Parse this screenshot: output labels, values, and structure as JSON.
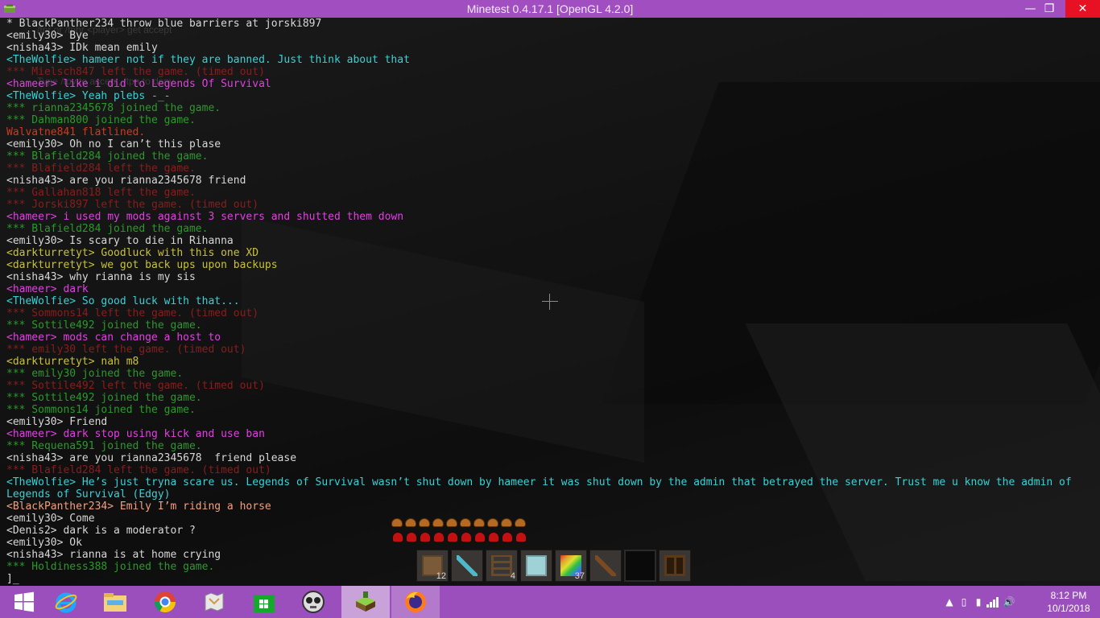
{
  "window": {
    "title": "Minetest 0.4.17.1 [OpenGL 4.2.0]"
  },
  "ghost_text": [
    "/tpr or /tphr <player> get accept",
    "Type /tpy to accept, /tpn to deny"
  ],
  "colors": {
    "normal": "#d8d8d8",
    "join": "#2a9a2a",
    "leave": "#8a1d1d",
    "death": "#d03a1e",
    "emote": "#d8d8d8",
    "wolfie": "#38d2d6",
    "hameer": "#e040e0",
    "darkturret": "#c8c238",
    "blackpanther": "#f0a080"
  },
  "chat": [
    {
      "text": "* BlackPanther234 throw blue barriers at jorski897",
      "kind": "emote"
    },
    {
      "text": "<emily30> Bye",
      "kind": "normal"
    },
    {
      "text": "<nisha43> IDk mean emily",
      "kind": "normal"
    },
    {
      "text": "<TheWolfie> hameer not if they are banned. Just think about that",
      "kind": "wolfie"
    },
    {
      "text": "*** Mielsch847 left the game. (timed out)",
      "kind": "leave"
    },
    {
      "text": "<hameer> like i did to Legends Of Survival",
      "kind": "hameer"
    },
    {
      "text": "<TheWolfie> Yeah plebs -_-",
      "kind": "wolfie"
    },
    {
      "text": "*** rianna2345678 joined the game.",
      "kind": "join"
    },
    {
      "text": "*** Dahman800 joined the game.",
      "kind": "join"
    },
    {
      "text": "Walvatne841 flatlined.",
      "kind": "death"
    },
    {
      "text": "<emily30> Oh no I can’t this plase",
      "kind": "normal"
    },
    {
      "text": "*** Blafield284 joined the game.",
      "kind": "join"
    },
    {
      "text": "*** Blafield284 left the game.",
      "kind": "leave"
    },
    {
      "text": "<nisha43> are you rianna2345678 friend",
      "kind": "normal"
    },
    {
      "text": "*** Gallahan818 left the game.",
      "kind": "leave"
    },
    {
      "text": "*** Jorski897 left the game. (timed out)",
      "kind": "leave"
    },
    {
      "text": "<hameer> i used my mods against 3 servers and shutted them down",
      "kind": "hameer"
    },
    {
      "text": "*** Blafield284 joined the game.",
      "kind": "join"
    },
    {
      "text": "<emily30> Is scary to die in Rihanna",
      "kind": "normal"
    },
    {
      "text": "<darkturretyt> Goodluck with this one XD",
      "kind": "darkturret"
    },
    {
      "text": "<darkturretyt> we got back ups upon backups",
      "kind": "darkturret"
    },
    {
      "text": "<nisha43> why rianna is my sis",
      "kind": "normal"
    },
    {
      "text": "<hameer> dark",
      "kind": "hameer"
    },
    {
      "text": "<TheWolfie> So good luck with that...",
      "kind": "wolfie"
    },
    {
      "text": "*** Sommons14 left the game. (timed out)",
      "kind": "leave"
    },
    {
      "text": "*** Sottile492 joined the game.",
      "kind": "join"
    },
    {
      "text": "<hameer> mods can change a host to",
      "kind": "hameer"
    },
    {
      "text": "*** emily30 left the game. (timed out)",
      "kind": "leave"
    },
    {
      "text": "<darkturretyt> nah m8",
      "kind": "darkturret"
    },
    {
      "text": "*** emily30 joined the game.",
      "kind": "join"
    },
    {
      "text": "*** Sottile492 left the game. (timed out)",
      "kind": "leave"
    },
    {
      "text": "*** Sottile492 joined the game.",
      "kind": "join"
    },
    {
      "text": "*** Sommons14 joined the game.",
      "kind": "join"
    },
    {
      "text": "<emily30> Friend",
      "kind": "normal"
    },
    {
      "text": "<hameer> dark stop using kick and use ban",
      "kind": "hameer"
    },
    {
      "text": "*** Requena591 joined the game.",
      "kind": "join"
    },
    {
      "text": "<nisha43> are you rianna2345678  friend please",
      "kind": "normal"
    },
    {
      "text": "*** Blafield284 left the game. (timed out)",
      "kind": "leave"
    },
    {
      "text": "<TheWolfie> He’s just tryna scare us. Legends of Survival wasn’t shut down by hameer it was shut down by the admin that betrayed the server. Trust me u know the admin of Legends of Survival (Edgy)",
      "kind": "wolfie"
    },
    {
      "text": "<BlackPanther234> Emily I’m riding a horse",
      "kind": "blackpanther"
    },
    {
      "text": "<emily30> Come",
      "kind": "normal"
    },
    {
      "text": "<Denis2> dark is a moderator ?",
      "kind": "normal"
    },
    {
      "text": "<emily30> Ok",
      "kind": "normal"
    },
    {
      "text": "<nisha43> rianna is at home crying",
      "kind": "normal"
    },
    {
      "text": "*** Holdiness388 joined the game.",
      "kind": "join"
    }
  ],
  "input": {
    "text": "]_"
  },
  "hud": {
    "hunger_count": 10,
    "hearts_count": 10,
    "hotbar": [
      {
        "icon": "wood-planks-icon",
        "count": "12",
        "color": "#7a5a38"
      },
      {
        "icon": "diamond-shovel-icon",
        "count": "",
        "color": "#4fb8c8"
      },
      {
        "icon": "ladder-icon",
        "count": "4",
        "color": "#6a4a28"
      },
      {
        "icon": "ice-block-icon",
        "count": "",
        "color": "#9fd2d6"
      },
      {
        "icon": "rainbow-block-icon",
        "count": "37",
        "color": "#c04fd0"
      },
      {
        "icon": "pickaxe-icon",
        "count": "",
        "color": "#7a4a22"
      },
      {
        "icon": "empty-slot-icon",
        "count": "",
        "color": "#000000"
      },
      {
        "icon": "crafting-grid-icon",
        "count": "",
        "color": "#5a3a1a"
      }
    ]
  },
  "taskbar": {
    "clock_time": "8:12 PM",
    "clock_date": "10/1/2018"
  }
}
